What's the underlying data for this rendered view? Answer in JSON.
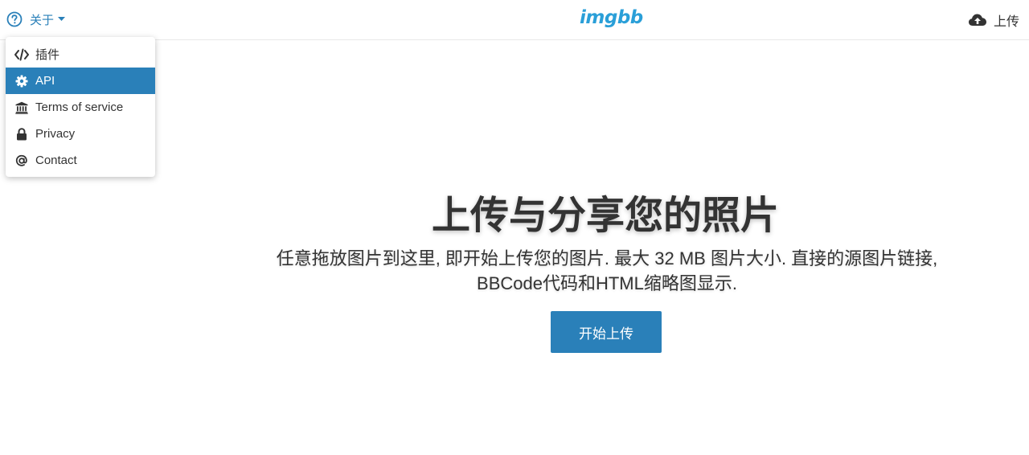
{
  "header": {
    "about_label": "关于",
    "logo_text": "imgbb",
    "upload_label": "上传"
  },
  "menu": {
    "items": [
      {
        "label": "插件",
        "icon": "code-icon"
      },
      {
        "label": "API",
        "icon": "gear-icon",
        "active": true
      },
      {
        "label": "Terms of service",
        "icon": "bank-icon"
      },
      {
        "label": "Privacy",
        "icon": "lock-icon"
      },
      {
        "label": "Contact",
        "icon": "at-icon"
      }
    ]
  },
  "hero": {
    "title": "上传与分享您的照片",
    "description": "任意拖放图片到这里, 即开始上传您的图片. 最大 32 MB 图片大小. 直接的源图片链接, BBCode代码和HTML缩略图显示.",
    "start_button": "开始上传"
  },
  "colors": {
    "accent": "#2a80b9",
    "logo": "#2a9fd8",
    "text": "#333333"
  }
}
